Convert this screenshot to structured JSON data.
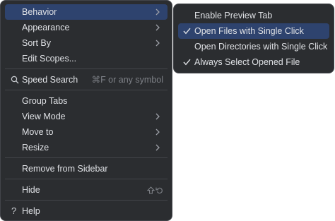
{
  "main_menu": {
    "behavior": "Behavior",
    "appearance": "Appearance",
    "sort_by": "Sort By",
    "edit_scopes": "Edit Scopes...",
    "speed_search": "Speed Search",
    "speed_search_hint": "⌘F or any symbol",
    "group_tabs": "Group Tabs",
    "view_mode": "View Mode",
    "move_to": "Move to",
    "resize": "Resize",
    "remove_from_sidebar": "Remove from Sidebar",
    "hide": "Hide",
    "help": "Help"
  },
  "behavior_submenu": {
    "enable_preview_tab": "Enable Preview Tab",
    "open_files_single_click": "Open Files with Single Click",
    "open_directories_single_click": "Open Directories with Single Click",
    "always_select_opened_file": "Always Select Opened File"
  },
  "colors": {
    "menu_background": "#2b2d30",
    "selection": "#2e436e",
    "text": "#dfe1e5",
    "muted_text": "#7e8187"
  }
}
